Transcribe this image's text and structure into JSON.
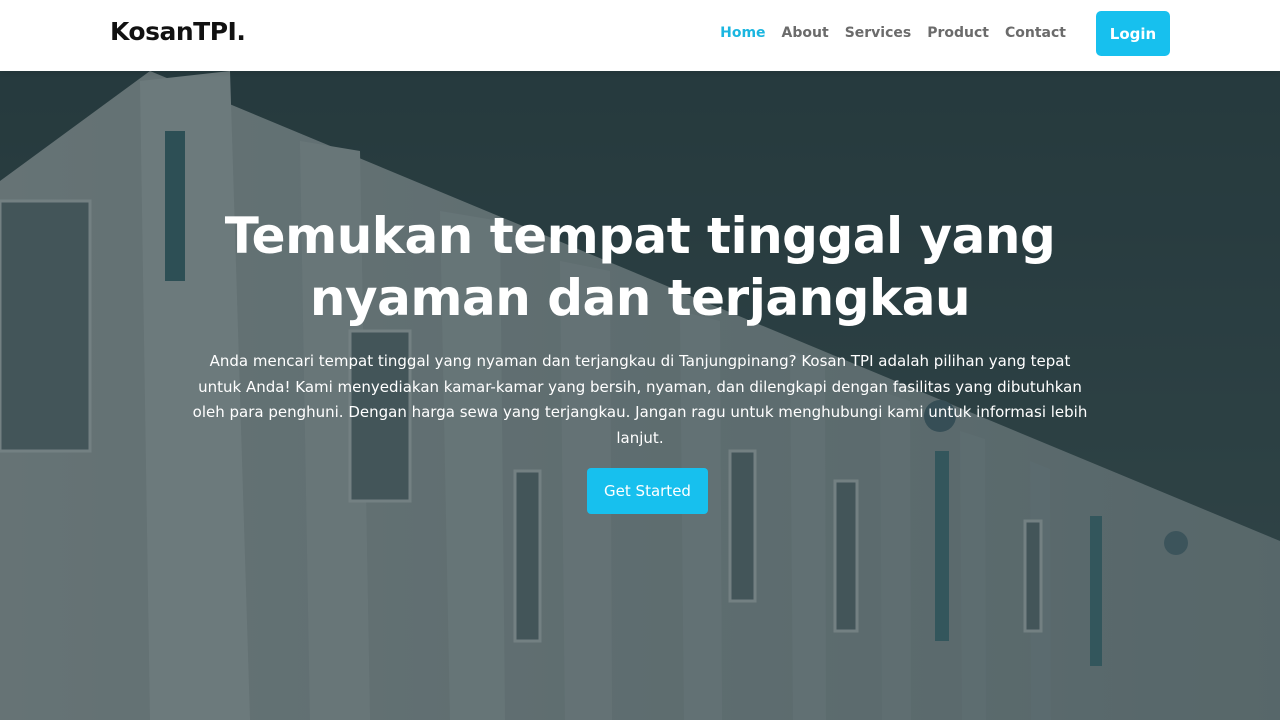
{
  "brand": {
    "name": "KosanTPI."
  },
  "nav": {
    "items": [
      {
        "label": "Home",
        "active": true
      },
      {
        "label": "About",
        "active": false
      },
      {
        "label": "Services",
        "active": false
      },
      {
        "label": "Product",
        "active": false
      },
      {
        "label": "Contact",
        "active": false
      }
    ],
    "login_label": "Login"
  },
  "hero": {
    "title": "Temukan tempat tinggal yang nyaman dan terjangkau",
    "description": "Anda mencari tempat tinggal yang nyaman dan terjangkau di Tanjungpinang? Kosan TPI adalah pilihan yang tepat untuk Anda! Kami menyediakan kamar-kamar yang bersih, nyaman, dan dilengkapi dengan fasilitas yang dibutuhkan oleh para penghuni. Dengan harga sewa yang terjangkau. Jangan ragu untuk menghubungi kami untuk informasi lebih lanjut.",
    "cta_label": "Get Started"
  },
  "colors": {
    "accent": "#17c0ee",
    "nav_active": "#1bb6e0",
    "nav_text": "#6b6b6b",
    "overlay": "#14282c"
  }
}
